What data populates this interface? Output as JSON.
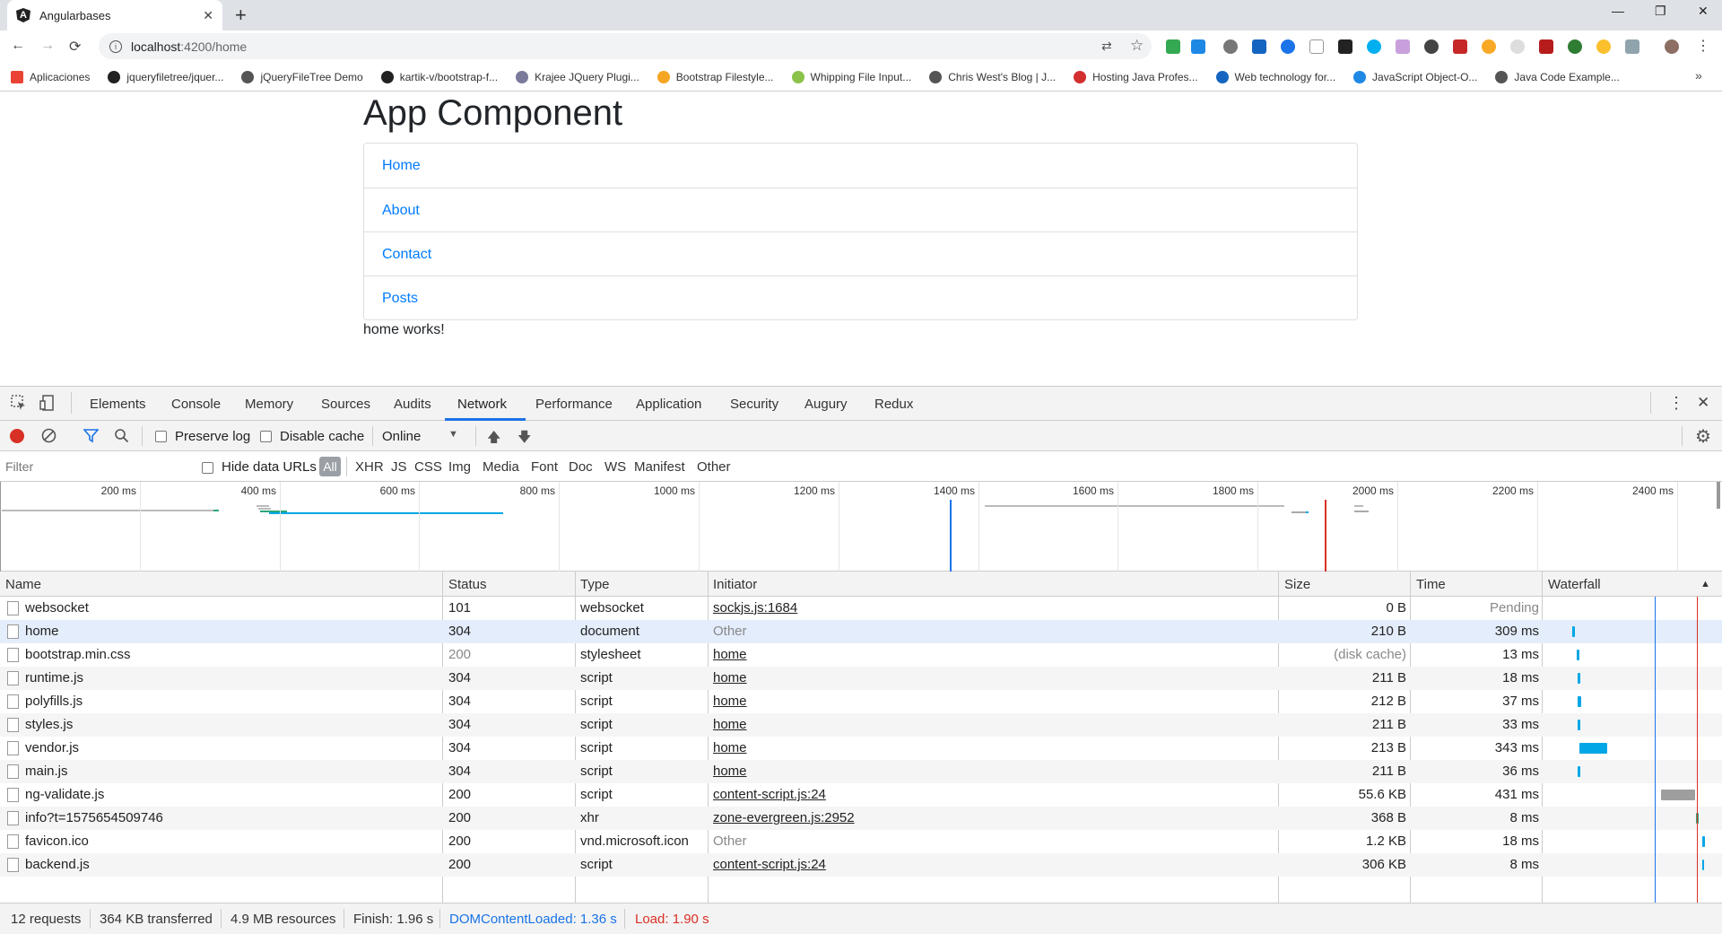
{
  "browser": {
    "tab_title": "Angularbases",
    "tab_icon_letter": "A",
    "url_host": "localhost",
    "url_path": ":4200/home",
    "bookmarks": [
      {
        "label": "Aplicaciones",
        "color": "#ea4335"
      },
      {
        "label": "jqueryfiletree/jquer...",
        "color": "#222222"
      },
      {
        "label": "jQueryFileTree Demo",
        "color": "#555555"
      },
      {
        "label": "kartik-v/bootstrap-f...",
        "color": "#222222"
      },
      {
        "label": "Krajee JQuery Plugi...",
        "color": "#7a7a9a"
      },
      {
        "label": "Bootstrap Filestyle...",
        "color": "#f5a623"
      },
      {
        "label": "Whipping File Input...",
        "color": "#8bc34a"
      },
      {
        "label": "Chris West's Blog | J...",
        "color": "#555555"
      },
      {
        "label": "Hosting Java Profes...",
        "color": "#d32f2f"
      },
      {
        "label": "Web technology for...",
        "color": "#1565c0"
      },
      {
        "label": "JavaScript Object-O...",
        "color": "#1e88e5"
      },
      {
        "label": "Java Code Example...",
        "color": "#555555"
      }
    ]
  },
  "page": {
    "heading": "App Component",
    "nav": [
      "Home",
      "About",
      "Contact",
      "Posts"
    ],
    "content": "home works!"
  },
  "devtools": {
    "tabs": [
      "Elements",
      "Console",
      "Memory",
      "Sources",
      "Audits",
      "Network",
      "Performance",
      "Application",
      "Security",
      "Augury",
      "Redux"
    ],
    "active_tab": "Network",
    "preserve_log": "Preserve log",
    "disable_cache": "Disable cache",
    "throttle": "Online",
    "filter_placeholder": "Filter",
    "hide_data_urls": "Hide data URLs",
    "filter_types": [
      "All",
      "XHR",
      "JS",
      "CSS",
      "Img",
      "Media",
      "Font",
      "Doc",
      "WS",
      "Manifest",
      "Other"
    ],
    "overview_ticks": [
      "200 ms",
      "400 ms",
      "600 ms",
      "800 ms",
      "1000 ms",
      "1200 ms",
      "1400 ms",
      "1600 ms",
      "1800 ms",
      "2000 ms",
      "2200 ms",
      "2400 ms"
    ],
    "columns": {
      "name": "Name",
      "status": "Status",
      "type": "Type",
      "initiator": "Initiator",
      "size": "Size",
      "time": "Time",
      "waterfall": "Waterfall"
    },
    "requests": [
      {
        "name": "websocket",
        "status": "101",
        "type": "websocket",
        "initiator": "sockjs.js:1684",
        "initiator_link": true,
        "size": "0 B",
        "time": "Pending",
        "time_muted": true
      },
      {
        "name": "home",
        "status": "304",
        "type": "document",
        "initiator": "Other",
        "initiator_link": false,
        "size": "210 B",
        "time": "309 ms",
        "selected": true
      },
      {
        "name": "bootstrap.min.css",
        "status": "200",
        "status_muted": true,
        "type": "stylesheet",
        "initiator": "home",
        "initiator_link": true,
        "size": "(disk cache)",
        "size_muted": true,
        "time": "13 ms"
      },
      {
        "name": "runtime.js",
        "status": "304",
        "type": "script",
        "initiator": "home",
        "initiator_link": true,
        "size": "211 B",
        "time": "18 ms"
      },
      {
        "name": "polyfills.js",
        "status": "304",
        "type": "script",
        "initiator": "home",
        "initiator_link": true,
        "size": "212 B",
        "time": "37 ms"
      },
      {
        "name": "styles.js",
        "status": "304",
        "type": "script",
        "initiator": "home",
        "initiator_link": true,
        "size": "211 B",
        "time": "33 ms"
      },
      {
        "name": "vendor.js",
        "status": "304",
        "type": "script",
        "initiator": "home",
        "initiator_link": true,
        "size": "213 B",
        "time": "343 ms"
      },
      {
        "name": "main.js",
        "status": "304",
        "type": "script",
        "initiator": "home",
        "initiator_link": true,
        "size": "211 B",
        "time": "36 ms"
      },
      {
        "name": "ng-validate.js",
        "status": "200",
        "type": "script",
        "initiator": "content-script.js:24",
        "initiator_link": true,
        "size": "55.6 KB",
        "time": "431 ms"
      },
      {
        "name": "info?t=1575654509746",
        "status": "200",
        "type": "xhr",
        "initiator": "zone-evergreen.js:2952",
        "initiator_link": true,
        "size": "368 B",
        "time": "8 ms"
      },
      {
        "name": "favicon.ico",
        "status": "200",
        "type": "vnd.microsoft.icon",
        "initiator": "Other",
        "initiator_link": false,
        "size": "1.2 KB",
        "time": "18 ms"
      },
      {
        "name": "backend.js",
        "status": "200",
        "type": "script",
        "initiator": "content-script.js:24",
        "initiator_link": true,
        "size": "306 KB",
        "time": "8 ms"
      }
    ],
    "summary": {
      "requests": "12 requests",
      "transferred": "364 KB transferred",
      "resources": "4.9 MB resources",
      "finish": "Finish: 1.96 s",
      "dcl": "DOMContentLoaded: 1.36 s",
      "load": "Load: 1.90 s"
    },
    "colors": {
      "accent": "#1a73e8",
      "dcl": "#1a73e8",
      "load": "#d93025",
      "bar": "#00a6e6"
    }
  }
}
